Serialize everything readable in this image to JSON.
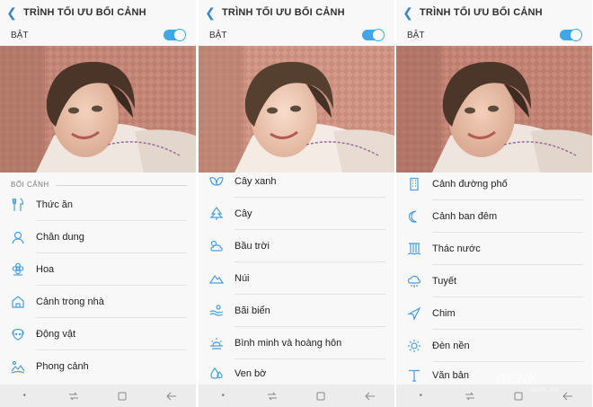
{
  "colors": {
    "accent": "#3fa6e8",
    "icon": "#4a9ede",
    "background": "#f8f8f8"
  },
  "screens": [
    {
      "header": {
        "title": "TRÌNH TỐI ƯU BỐI CẢNH",
        "back_icon": "chevron-left-icon"
      },
      "toggle": {
        "label": "BẬT",
        "state": "on"
      },
      "section_label": "BỐI CẢNH",
      "items": [
        {
          "label": "Thức ăn",
          "icon": "fork-knife-icon"
        },
        {
          "label": "Chân dung",
          "icon": "person-icon"
        },
        {
          "label": "Hoa",
          "icon": "flower-icon"
        },
        {
          "label": "Cảnh trong nhà",
          "icon": "house-icon"
        },
        {
          "label": "Động vật",
          "icon": "dog-icon"
        },
        {
          "label": "Phong cảnh",
          "icon": "landscape-icon"
        }
      ]
    },
    {
      "header": {
        "title": "TRÌNH TỐI ƯU BỐI CẢNH",
        "back_icon": "chevron-left-icon"
      },
      "toggle": {
        "label": "BẬT",
        "state": "on"
      },
      "items": [
        {
          "label": "Cây xanh",
          "icon": "leaf-icon"
        },
        {
          "label": "Cây",
          "icon": "tree-icon"
        },
        {
          "label": "Bầu trời",
          "icon": "sky-icon"
        },
        {
          "label": "Núi",
          "icon": "mountain-icon"
        },
        {
          "label": "Bãi biển",
          "icon": "beach-icon"
        },
        {
          "label": "Bình minh và hoàng hôn",
          "icon": "sunrise-icon"
        },
        {
          "label": "Ven bờ",
          "icon": "water-drop-icon"
        }
      ]
    },
    {
      "header": {
        "title": "TRÌNH TỐI ƯU BỐI CẢNH",
        "back_icon": "chevron-left-icon"
      },
      "toggle": {
        "label": "BẬT",
        "state": "on"
      },
      "items": [
        {
          "label": "Cảnh đường phố",
          "icon": "building-icon"
        },
        {
          "label": "Cảnh ban đêm",
          "icon": "moon-icon"
        },
        {
          "label": "Thác nước",
          "icon": "waterfall-icon"
        },
        {
          "label": "Tuyết",
          "icon": "snow-cloud-icon"
        },
        {
          "label": "Chim",
          "icon": "bird-icon"
        },
        {
          "label": "Đèn nền",
          "icon": "backlight-icon"
        },
        {
          "label": "Văn bản",
          "icon": "text-icon"
        }
      ]
    }
  ],
  "watermark": {
    "brand": "GENK",
    "site": "GENK.VN"
  }
}
